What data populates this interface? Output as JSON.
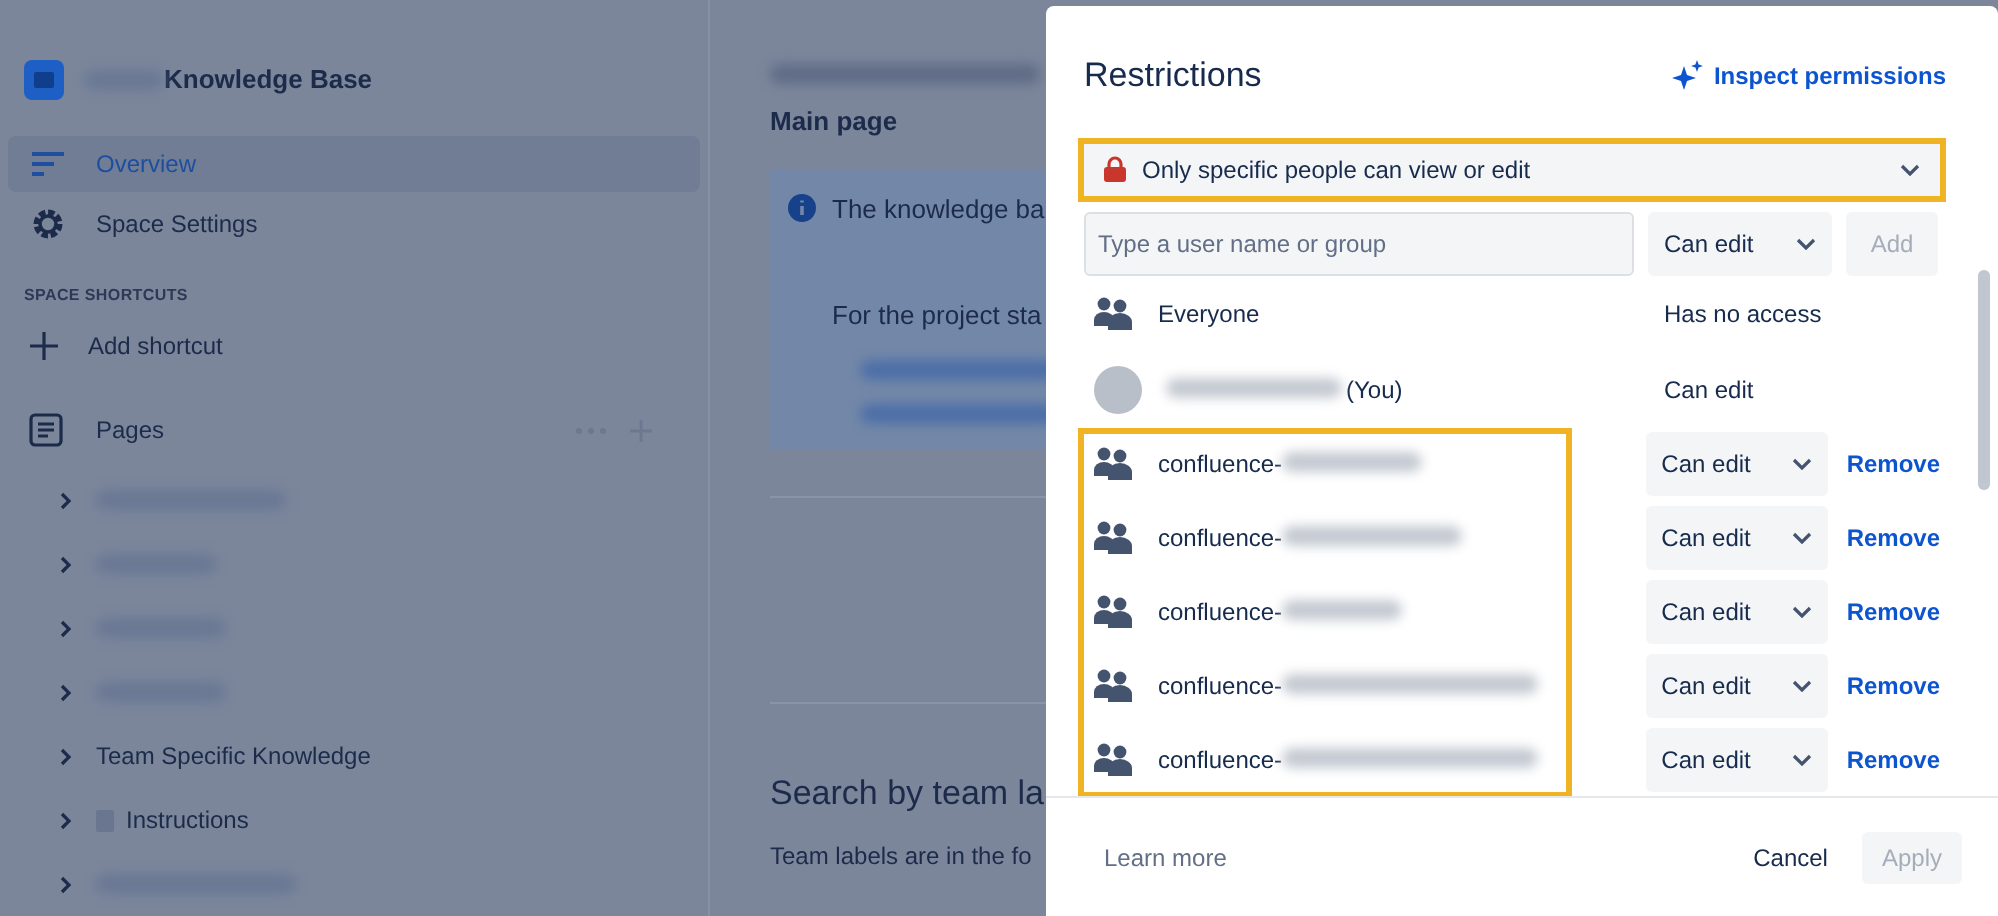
{
  "sidebar": {
    "space_title": "Knowledge Base",
    "nav": [
      {
        "kind": "overview",
        "label": "Overview",
        "selected": true
      },
      {
        "kind": "settings",
        "label": "Space Settings",
        "selected": false
      }
    ],
    "shortcuts_heading": "SPACE SHORTCUTS",
    "add_shortcut": "Add shortcut",
    "pages_heading": "Pages",
    "pages": [
      {
        "kind": "redacted"
      },
      {
        "kind": "redacted"
      },
      {
        "kind": "redacted"
      },
      {
        "kind": "redacted"
      },
      {
        "kind": "folder",
        "label": "Team Specific Knowledge"
      },
      {
        "kind": "document",
        "label": "Instructions"
      },
      {
        "kind": "redacted"
      }
    ]
  },
  "main": {
    "subtitle": "Main page",
    "info_lines": [
      "The knowledge ba",
      "For the project sta"
    ],
    "heading": "Search by team la",
    "paragraph": "Team labels are in the fo"
  },
  "dialog": {
    "title": "Restrictions",
    "inspect_link": "Inspect permissions",
    "restriction": {
      "label": "Only specific people can view or edit",
      "highlighted": true
    },
    "user_field": {
      "placeholder": "Type a user name or group"
    },
    "new_permission": "Can edit",
    "add_button": {
      "label": "Add",
      "disabled": true
    },
    "fixed_entries": [
      {
        "kind": "group",
        "name": "Everyone",
        "access": "Has no access"
      },
      {
        "kind": "user",
        "name": "(You)",
        "access": "Can edit"
      }
    ],
    "groups": {
      "highlighted": true,
      "items": [
        {
          "name": "confluence-",
          "access": "Can edit",
          "action": "Remove"
        },
        {
          "name": "confluence-",
          "access": "Can edit",
          "action": "Remove"
        },
        {
          "name": "confluence-",
          "access": "Can edit",
          "action": "Remove"
        },
        {
          "name": "confluence-",
          "access": "Can edit",
          "action": "Remove"
        },
        {
          "name": "confluence-",
          "access": "Can edit",
          "action": "Remove"
        }
      ]
    },
    "footer": {
      "link": "Learn more",
      "cancel": "Cancel",
      "apply": {
        "label": "Apply",
        "disabled": true
      }
    }
  }
}
